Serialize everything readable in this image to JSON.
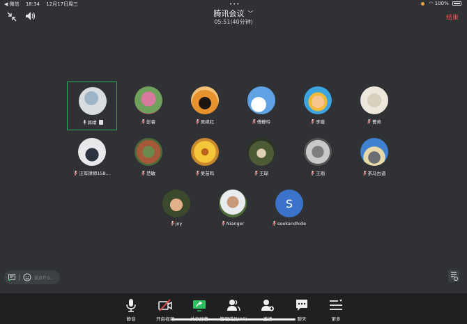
{
  "status_bar": {
    "back_app": "◀ 微信",
    "time": "18:34",
    "date": "12月17日周三",
    "battery": "100%"
  },
  "header": {
    "title": "腾讯会议",
    "duration": "05:51(40分钟)",
    "end_label": "结束"
  },
  "participants": [
    {
      "name": "郭靖",
      "active": true,
      "sharing": true,
      "mic": "on"
    },
    {
      "name": "彭睿",
      "mic": "muted"
    },
    {
      "name": "吴继红",
      "mic": "muted"
    },
    {
      "name": "傅静玲",
      "mic": "muted"
    },
    {
      "name": "李璇",
      "mic": "muted"
    },
    {
      "name": "曹帅",
      "mic": "muted"
    },
    {
      "name": "汪军律师158...",
      "mic": "muted"
    },
    {
      "name": "范敏",
      "mic": "muted"
    },
    {
      "name": "吴苗鸣",
      "mic": "muted"
    },
    {
      "name": "王琛",
      "mic": "muted"
    },
    {
      "name": "王刚",
      "mic": "muted"
    },
    {
      "name": "茶马古道",
      "mic": "muted"
    },
    {
      "name": "joy",
      "mic": "muted"
    },
    {
      "name": "Nianger",
      "mic": "muted"
    },
    {
      "name": "seekandhide",
      "mic": "muted",
      "initial": "S"
    }
  ],
  "chat": {
    "placeholder": "说点什么..."
  },
  "toolbar": {
    "mute": "静音",
    "video": "开启视频",
    "share": "共享屏幕",
    "members": "管理成员(15)",
    "invite": "邀请",
    "chat": "聊天",
    "more": "更多"
  },
  "colors": {
    "active_border": "#28b45c",
    "end_red": "#ff4a4a",
    "muted_red": "#e04848",
    "share_green": "#2fbf5f",
    "initial_avatar": "#3a73c9"
  }
}
